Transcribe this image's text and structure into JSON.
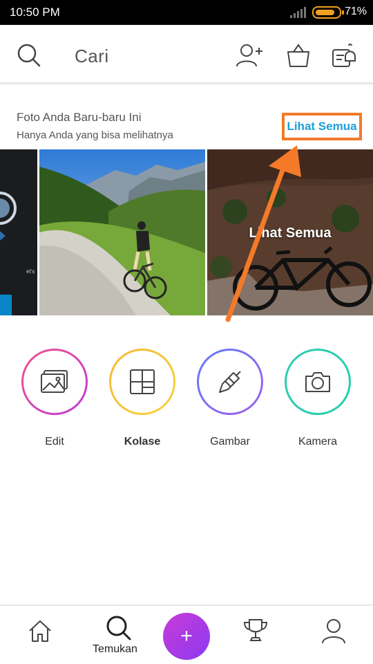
{
  "status_bar": {
    "time": "10:50 PM",
    "battery_percent": "71%",
    "battery_level": 0.71
  },
  "header": {
    "search_label": "Cari",
    "icons": [
      "search-icon",
      "add-user-icon",
      "shop-bag-icon",
      "notification-icon"
    ]
  },
  "recent": {
    "title": "Foto Anda Baru-baru Ini",
    "subtitle": "Hanya Anda yang bisa melihatnya",
    "see_all": "Lihat Semua",
    "overlay_label": "Lihat Semua",
    "photo_peek_text": "et's"
  },
  "tools": [
    {
      "label": "Edit",
      "icon": "image-icon",
      "color_from": "#f0538a",
      "color_to": "#c03ad8"
    },
    {
      "label": "Kolase",
      "icon": "collage-icon",
      "color_from": "#f7b733",
      "color_to": "#f5d33c"
    },
    {
      "label": "Gambar",
      "icon": "brush-icon",
      "color_from": "#5f7cf5",
      "color_to": "#a35ff0"
    },
    {
      "label": "Kamera",
      "icon": "camera-icon",
      "color_from": "#2fcbb4",
      "color_to": "#22d0a8"
    }
  ],
  "bottom_nav": {
    "discover_label": "Temukan",
    "fab_symbol": "+",
    "items": [
      "home-icon",
      "discover-icon",
      "create-button",
      "trophy-icon",
      "profile-icon"
    ]
  },
  "colors": {
    "highlight_box": "#f47a29",
    "link": "#1a9fd8",
    "arrow": "#f47a29"
  }
}
